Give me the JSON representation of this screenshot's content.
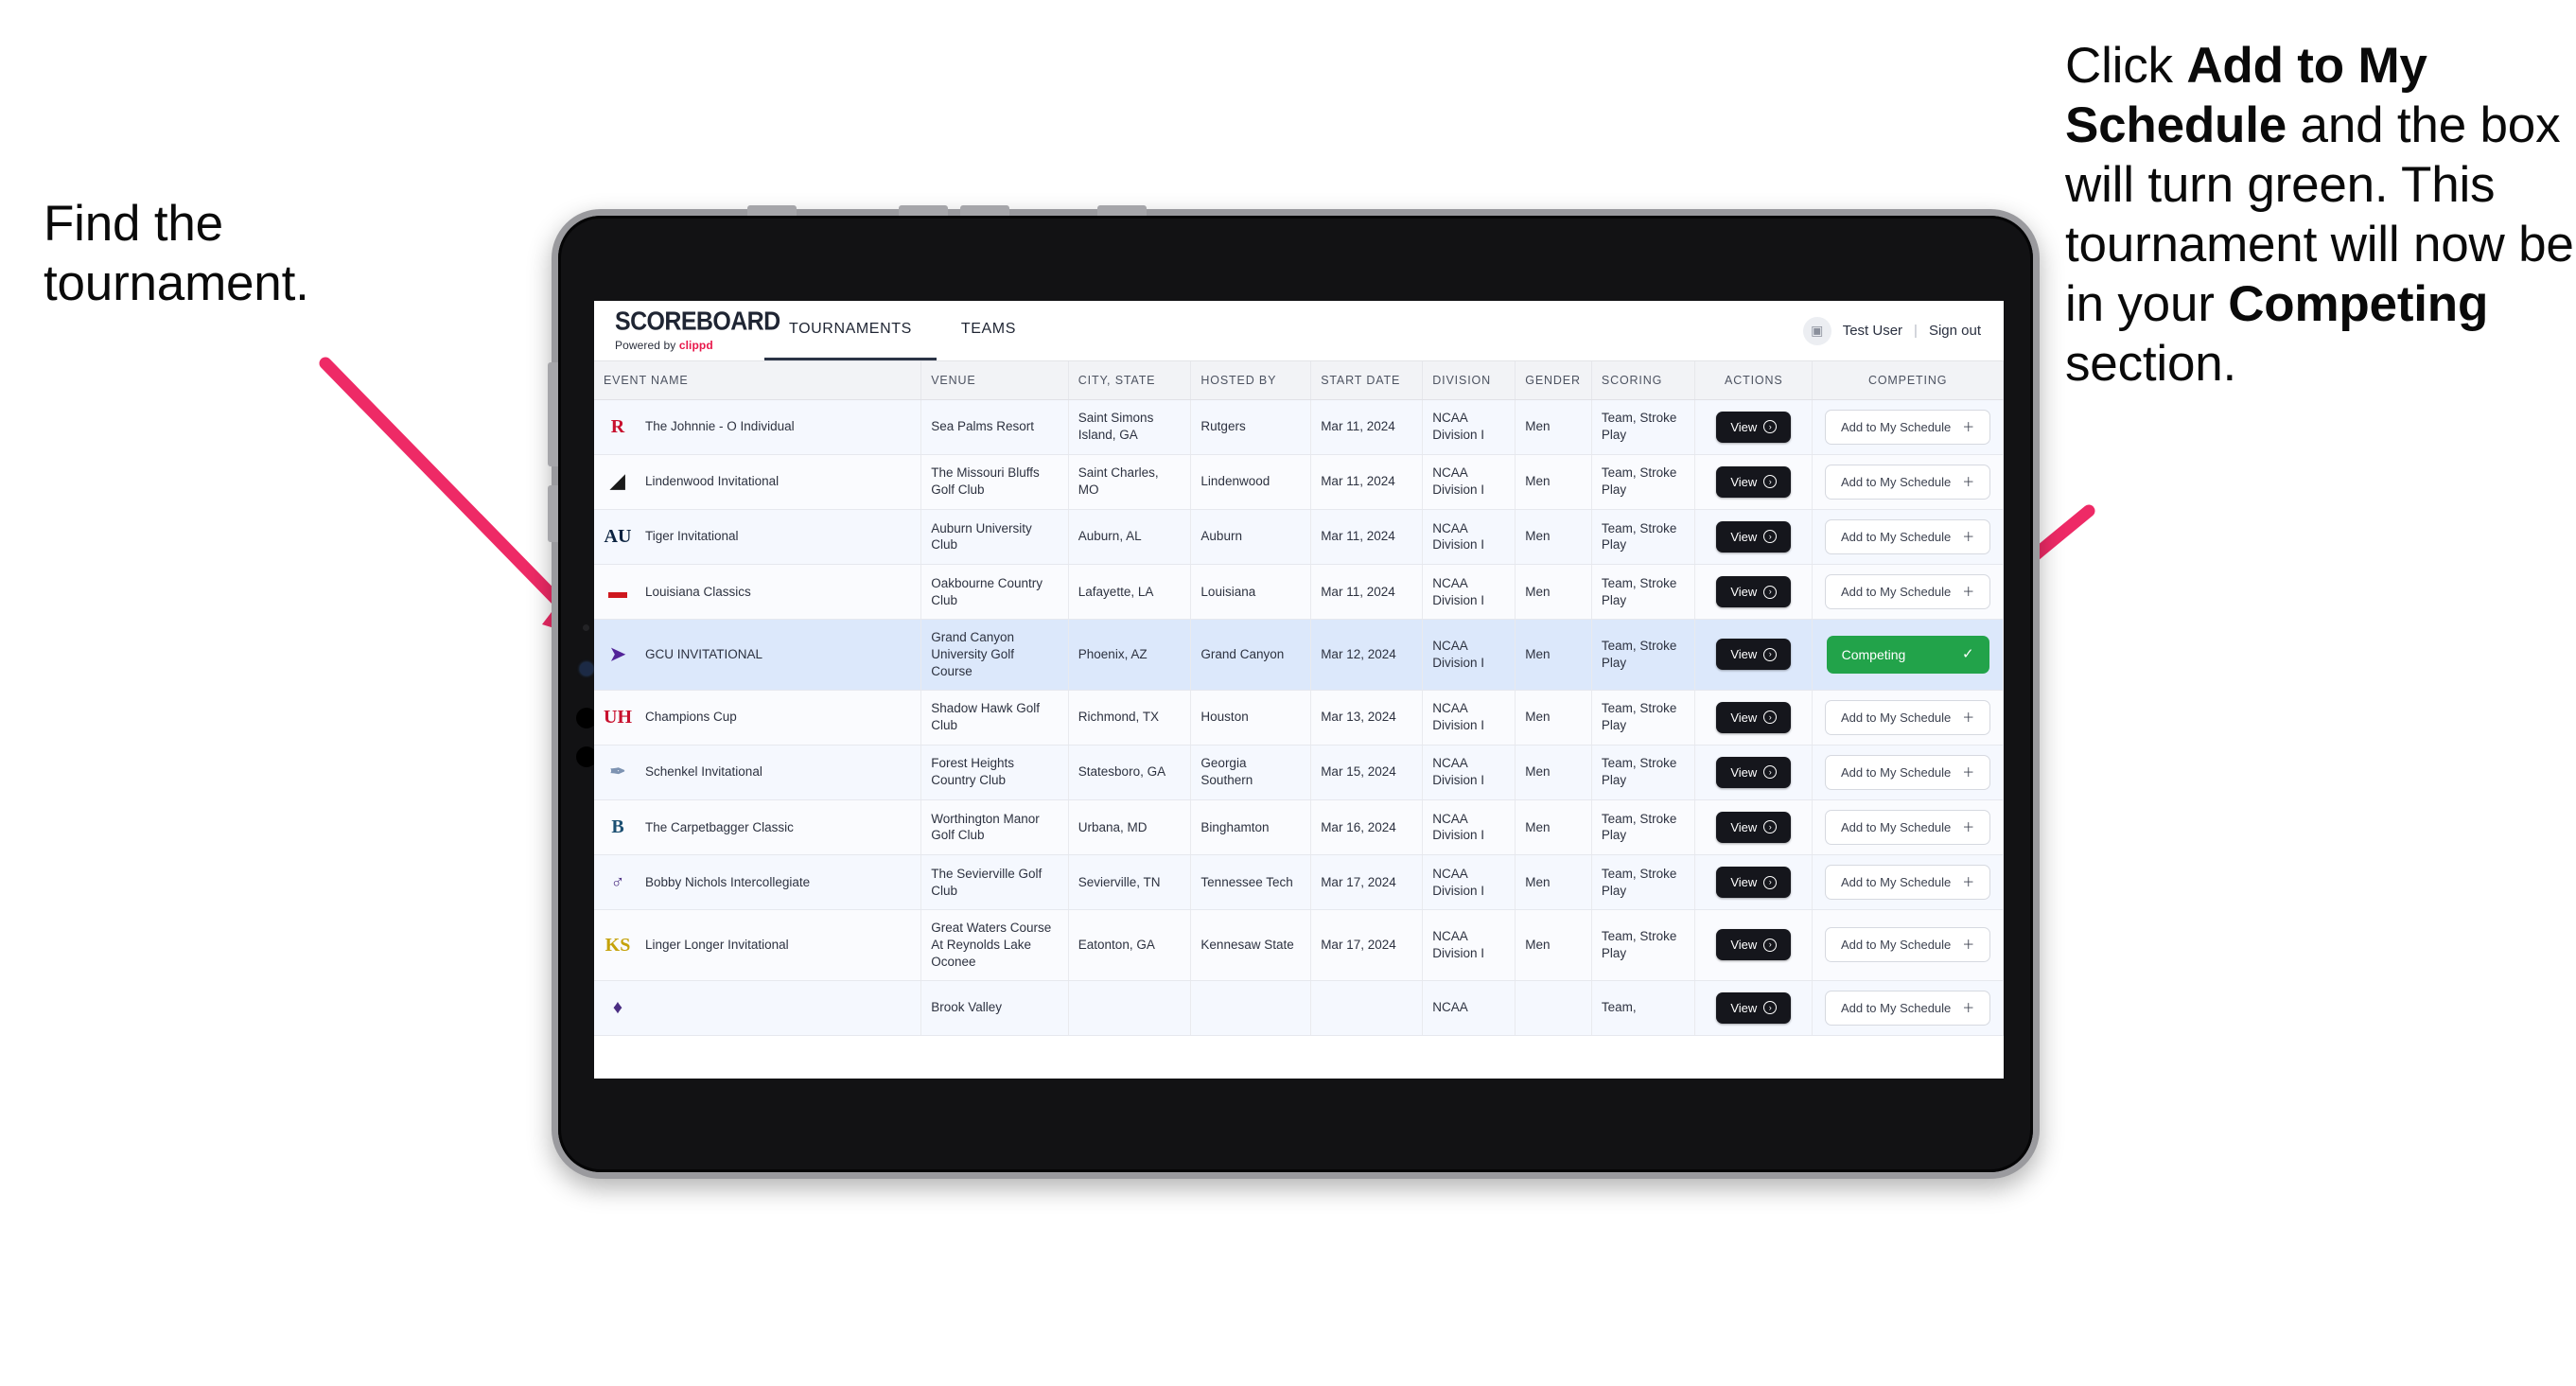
{
  "annotations": {
    "left": {
      "line1": "Find the",
      "line2": "tournament."
    },
    "right": {
      "seg1": "Click ",
      "bold1": "Add to My Schedule",
      "seg2": " and the box will turn green. This tournament will now be in your ",
      "bold2": "Competing",
      "seg3": " section."
    },
    "arrow_color": "#ee2a66"
  },
  "app": {
    "brand": {
      "title": "SCOREBOARD",
      "powered_prefix": "Powered by ",
      "powered_name": "clippd"
    },
    "nav_tabs": [
      {
        "label": "TOURNAMENTS",
        "active": true
      },
      {
        "label": "TEAMS",
        "active": false
      }
    ],
    "account": {
      "avatar_glyph": "▣",
      "user": "Test User",
      "separator": "|",
      "sign_out": "Sign out"
    },
    "table": {
      "columns": [
        "EVENT NAME",
        "VENUE",
        "CITY, STATE",
        "HOSTED BY",
        "START DATE",
        "DIVISION",
        "GENDER",
        "SCORING",
        "ACTIONS",
        "COMPETING"
      ],
      "view_label": "View",
      "view_icon": "arrow-right-circle-icon",
      "add_label": "Add to My Schedule",
      "add_icon": "plus-icon",
      "competing_label": "Competing",
      "competing_icon": "check-icon",
      "competing_color": "#22a34a",
      "rows": [
        {
          "logo": "R",
          "logo_color": "#c8102e",
          "event": "The Johnnie - O Individual",
          "venue": "Sea Palms Resort",
          "city": "Saint Simons Island, GA",
          "host": "Rutgers",
          "date": "Mar 11, 2024",
          "division": "NCAA Division I",
          "gender": "Men",
          "scoring": "Team, Stroke Play",
          "competing": false
        },
        {
          "logo": "◢",
          "logo_color": "#1a1a1a",
          "event": "Lindenwood Invitational",
          "venue": "The Missouri Bluffs Golf Club",
          "city": "Saint Charles, MO",
          "host": "Lindenwood",
          "date": "Mar 11, 2024",
          "division": "NCAA Division I",
          "gender": "Men",
          "scoring": "Team, Stroke Play",
          "competing": false
        },
        {
          "logo": "AU",
          "logo_color": "#0c2340",
          "event": "Tiger Invitational",
          "venue": "Auburn University Club",
          "city": "Auburn, AL",
          "host": "Auburn",
          "date": "Mar 11, 2024",
          "division": "NCAA Division I",
          "gender": "Men",
          "scoring": "Team, Stroke Play",
          "competing": false
        },
        {
          "logo": "▬",
          "logo_color": "#ce181e",
          "event": "Louisiana Classics",
          "venue": "Oakbourne Country Club",
          "city": "Lafayette, LA",
          "host": "Louisiana",
          "date": "Mar 11, 2024",
          "division": "NCAA Division I",
          "gender": "Men",
          "scoring": "Team, Stroke Play",
          "competing": false
        },
        {
          "logo": "➤",
          "logo_color": "#522398",
          "event": "GCU INVITATIONAL",
          "venue": "Grand Canyon University Golf Course",
          "city": "Phoenix, AZ",
          "host": "Grand Canyon",
          "date": "Mar 12, 2024",
          "division": "NCAA Division I",
          "gender": "Men",
          "scoring": "Team, Stroke Play",
          "competing": true,
          "selected": true
        },
        {
          "logo": "UH",
          "logo_color": "#c8102e",
          "event": "Champions Cup",
          "venue": "Shadow Hawk Golf Club",
          "city": "Richmond, TX",
          "host": "Houston",
          "date": "Mar 13, 2024",
          "division": "NCAA Division I",
          "gender": "Men",
          "scoring": "Team, Stroke Play",
          "competing": false
        },
        {
          "logo": "✒",
          "logo_color": "#7d93b2",
          "event": "Schenkel Invitational",
          "venue": "Forest Heights Country Club",
          "city": "Statesboro, GA",
          "host": "Georgia Southern",
          "date": "Mar 15, 2024",
          "division": "NCAA Division I",
          "gender": "Men",
          "scoring": "Team, Stroke Play",
          "competing": false
        },
        {
          "logo": "B",
          "logo_color": "#1b4f72",
          "event": "The Carpetbagger Classic",
          "venue": "Worthington Manor Golf Club",
          "city": "Urbana, MD",
          "host": "Binghamton",
          "date": "Mar 16, 2024",
          "division": "NCAA Division I",
          "gender": "Men",
          "scoring": "Team, Stroke Play",
          "competing": false
        },
        {
          "logo": "♂",
          "logo_color": "#4b2e83",
          "event": "Bobby Nichols Intercollegiate",
          "venue": "The Sevierville Golf Club",
          "city": "Sevierville, TN",
          "host": "Tennessee Tech",
          "date": "Mar 17, 2024",
          "division": "NCAA Division I",
          "gender": "Men",
          "scoring": "Team, Stroke Play",
          "competing": false
        },
        {
          "logo": "KS",
          "logo_color": "#c5a20a",
          "event": "Linger Longer Invitational",
          "venue": "Great Waters Course At Reynolds Lake Oconee",
          "city": "Eatonton, GA",
          "host": "Kennesaw State",
          "date": "Mar 17, 2024",
          "division": "NCAA Division I",
          "gender": "Men",
          "scoring": "Team, Stroke Play",
          "competing": false
        },
        {
          "logo": "♦",
          "logo_color": "#4b2e83",
          "event": "",
          "venue": "Brook Valley",
          "city": "",
          "host": "",
          "date": "",
          "division": "NCAA",
          "gender": "",
          "scoring": "Team,",
          "competing": false,
          "clipped": true
        }
      ]
    }
  }
}
